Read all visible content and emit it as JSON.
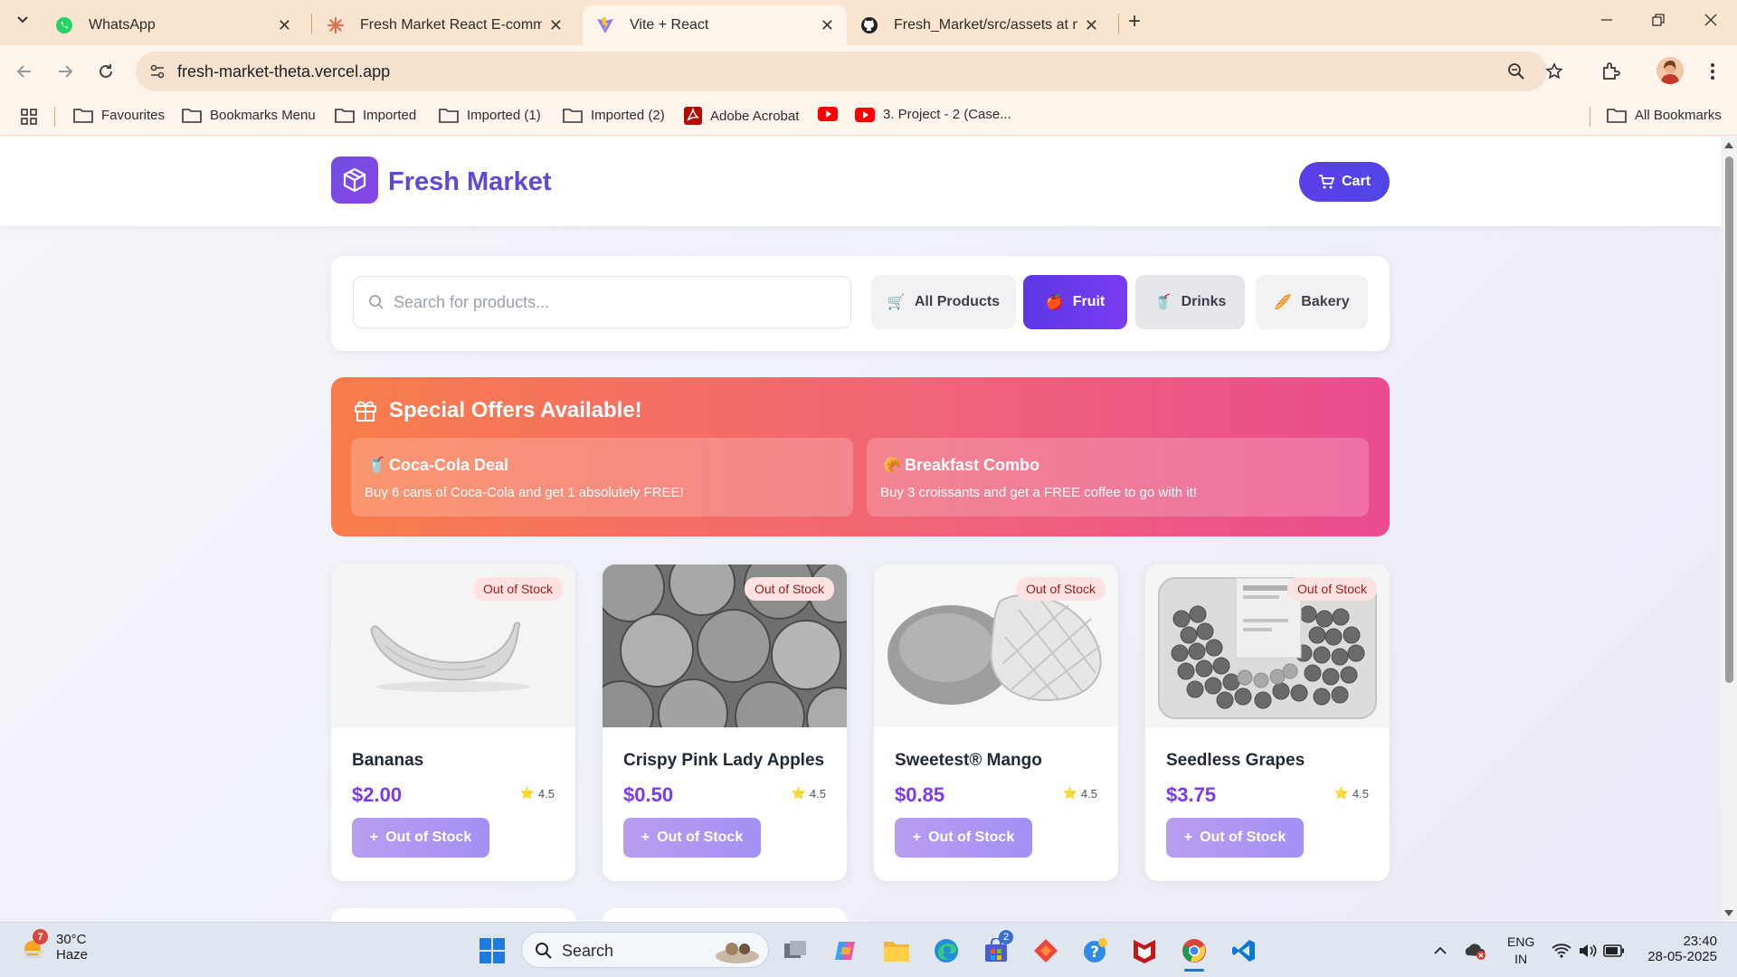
{
  "browser": {
    "tabs": [
      {
        "title": "WhatsApp",
        "icon": "whatsapp-icon"
      },
      {
        "title": "Fresh Market React E-commerce",
        "icon": "claude-icon"
      },
      {
        "title": "Vite + React",
        "icon": "vite-icon"
      },
      {
        "title": "Fresh_Market/src/assets at main",
        "icon": "github-icon"
      }
    ],
    "url": "fresh-market-theta.vercel.app",
    "bookmarks": [
      "Favourites",
      "Bookmarks Menu",
      "Imported",
      "Imported (1)",
      "Imported (2)",
      "Adobe Acrobat",
      "",
      "3. Project - 2 (Case..."
    ],
    "all_bookmarks": "All Bookmarks"
  },
  "site": {
    "brand": "Fresh Market",
    "cart_label": "Cart",
    "search_placeholder": "Search for products...",
    "categories": [
      {
        "label": "All Products",
        "icon": "🛒"
      },
      {
        "label": "Fruit",
        "icon": "🍎"
      },
      {
        "label": "Drinks",
        "icon": "🥤"
      },
      {
        "label": "Bakery",
        "icon": "🥖"
      }
    ],
    "active_category": "Fruit",
    "offers_title": "Special Offers Available!",
    "offers": [
      {
        "icon": "🥤",
        "title": "Coca-Cola Deal",
        "desc": "Buy 6 cans of Coca-Cola and get 1 absolutely FREE!"
      },
      {
        "icon": "🥐",
        "title": "Breakfast Combo",
        "desc": "Buy 3 croissants and get a FREE coffee to go with it!"
      }
    ],
    "products": [
      {
        "name": "Bananas",
        "price": "$2.00",
        "rating": "4.5",
        "badge": "Out of Stock",
        "button": "Out of Stock"
      },
      {
        "name": "Crispy Pink Lady Apples",
        "price": "$0.50",
        "rating": "4.5",
        "badge": "Out of Stock",
        "button": "Out of Stock"
      },
      {
        "name": "Sweetest® Mango",
        "price": "$0.85",
        "rating": "4.5",
        "badge": "Out of Stock",
        "button": "Out of Stock"
      },
      {
        "name": "Seedless Grapes",
        "price": "$3.75",
        "rating": "4.5",
        "badge": "Out of Stock",
        "button": "Out of Stock"
      }
    ],
    "colors": {
      "accent": "#5b4ad6",
      "price": "#7c3aed",
      "offer_start": "#f87d4a",
      "offer_end": "#ea4c8f"
    }
  },
  "taskbar": {
    "temp": "30°C",
    "weather": "Haze",
    "weather_badge": "7",
    "search": "Search",
    "store_badge": "2",
    "lang": "ENG",
    "region": "IN",
    "time": "23:40",
    "date": "28-05-2025"
  }
}
